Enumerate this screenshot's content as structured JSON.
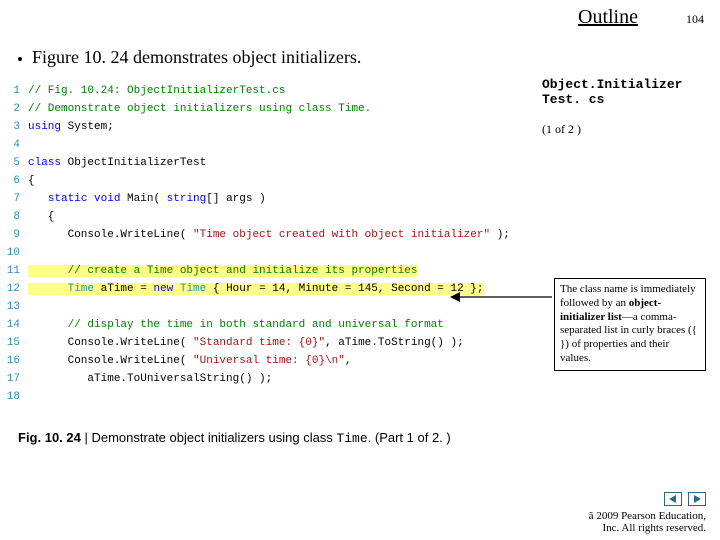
{
  "header": {
    "outline": "Outline",
    "page": "104"
  },
  "bullet": "Figure 10. 24 demonstrates object initializers.",
  "side": {
    "title_line1": "Object.Initializer",
    "title_line2": "Test. cs",
    "part": "(1 of 2 )"
  },
  "callout": {
    "pre": "The class name is immediately followed by an ",
    "bold": "object-initializer list",
    "post": "—a comma-separated list in curly braces ({ }) of properties and their values."
  },
  "code": {
    "lines": [
      {
        "n": "1",
        "hl": false,
        "tok": [
          [
            "comment",
            "// Fig. 10.24: ObjectInitializerTest.cs"
          ]
        ]
      },
      {
        "n": "2",
        "hl": false,
        "tok": [
          [
            "comment",
            "// Demonstrate object initializers using class Time."
          ]
        ]
      },
      {
        "n": "3",
        "hl": false,
        "tok": [
          [
            "key",
            "using"
          ],
          [
            "plain",
            " System;"
          ]
        ]
      },
      {
        "n": "4",
        "hl": false,
        "tok": []
      },
      {
        "n": "5",
        "hl": false,
        "tok": [
          [
            "key",
            "class"
          ],
          [
            "plain",
            " ObjectInitializerTest"
          ]
        ]
      },
      {
        "n": "6",
        "hl": false,
        "tok": [
          [
            "plain",
            "{"
          ]
        ]
      },
      {
        "n": "7",
        "hl": false,
        "tok": [
          [
            "plain",
            "   "
          ],
          [
            "key",
            "static"
          ],
          [
            "plain",
            " "
          ],
          [
            "key",
            "void"
          ],
          [
            "plain",
            " Main( "
          ],
          [
            "key",
            "string"
          ],
          [
            "plain",
            "[] args )"
          ]
        ]
      },
      {
        "n": "8",
        "hl": false,
        "tok": [
          [
            "plain",
            "   {"
          ]
        ]
      },
      {
        "n": "9",
        "hl": false,
        "tok": [
          [
            "plain",
            "      Console.WriteLine( "
          ],
          [
            "str",
            "\"Time object created with object initializer\""
          ],
          [
            "plain",
            " );"
          ]
        ]
      },
      {
        "n": "10",
        "hl": false,
        "tok": []
      },
      {
        "n": "11",
        "hl": true,
        "tok": [
          [
            "plain",
            "      "
          ],
          [
            "comment",
            "// create a Time object and initialize its properties"
          ]
        ]
      },
      {
        "n": "12",
        "hl": true,
        "tok": [
          [
            "plain",
            "      "
          ],
          [
            "type",
            "Time"
          ],
          [
            "plain",
            " aTime = "
          ],
          [
            "key",
            "new"
          ],
          [
            "plain",
            " "
          ],
          [
            "type",
            "Time"
          ],
          [
            "plain",
            " { Hour = 14, Minute = 145, Second = 12 };"
          ]
        ]
      },
      {
        "n": "13",
        "hl": false,
        "tok": []
      },
      {
        "n": "14",
        "hl": false,
        "tok": [
          [
            "plain",
            "      "
          ],
          [
            "comment",
            "// display the time in both standard and universal format"
          ]
        ]
      },
      {
        "n": "15",
        "hl": false,
        "tok": [
          [
            "plain",
            "      Console.WriteLine( "
          ],
          [
            "str",
            "\"Standard time: {0}\""
          ],
          [
            "plain",
            ", aTime.ToString() );"
          ]
        ]
      },
      {
        "n": "16",
        "hl": false,
        "tok": [
          [
            "plain",
            "      Console.WriteLine( "
          ],
          [
            "str",
            "\"Universal time: {0}\\n\""
          ],
          [
            "plain",
            ","
          ]
        ]
      },
      {
        "n": "17",
        "hl": false,
        "tok": [
          [
            "plain",
            "         aTime.ToUniversalString() );"
          ]
        ]
      },
      {
        "n": "18",
        "hl": false,
        "tok": []
      }
    ]
  },
  "caption": {
    "lead": "Fig. 10. 24 ",
    "sep": "| ",
    "text1": "Demonstrate object initializers using class ",
    "mono": "Time",
    "text2": ". (Part 1 of 2. )"
  },
  "footer": {
    "copyright_char": "ã",
    "line1_rest": " 2009 Pearson Education,",
    "line2": "Inc. All rights reserved."
  }
}
